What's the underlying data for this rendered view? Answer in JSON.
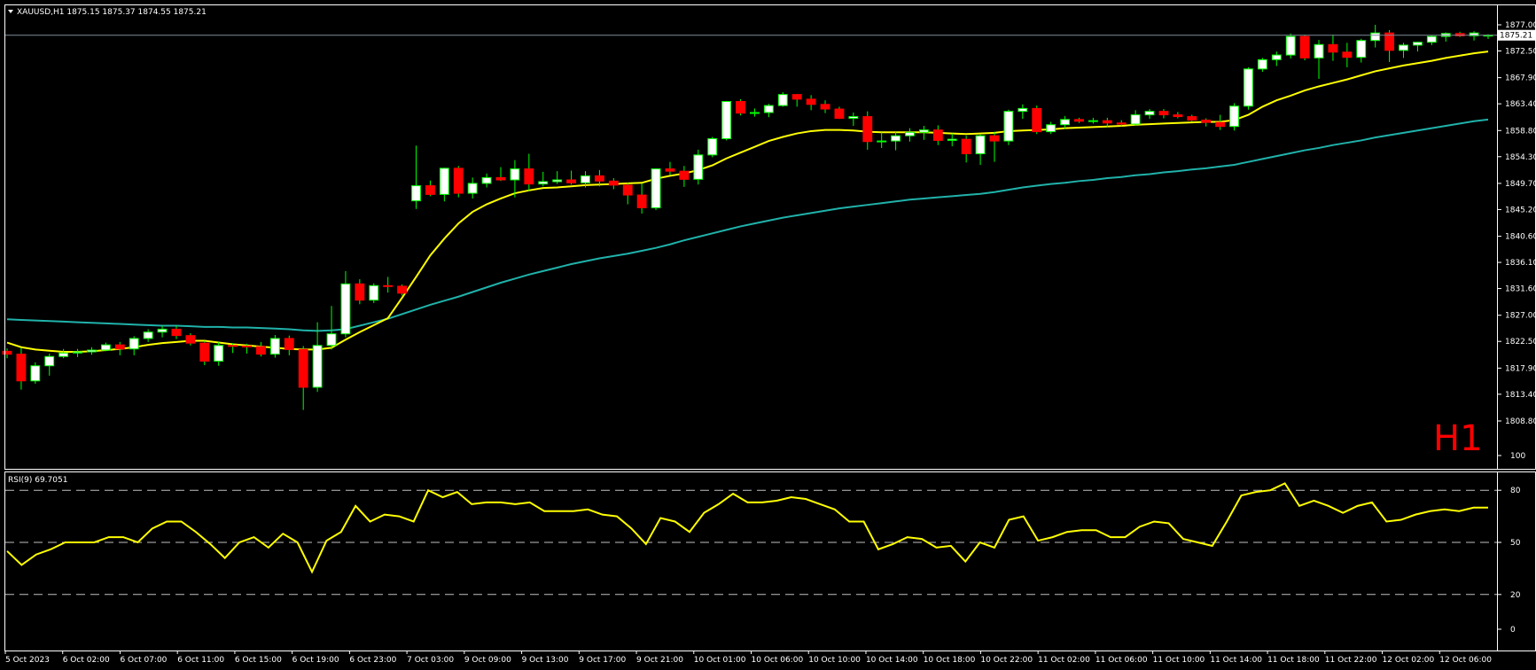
{
  "header": {
    "symbol_line": "XAUUSD,H1  1875.15 1875.37 1874.55 1875.21",
    "timeframe_label": "H1",
    "current_price_label": "1875.21"
  },
  "rsi_panel": {
    "label": "RSI(9) 69.7051"
  },
  "colors": {
    "background": "#000000",
    "frame": "#ffffff",
    "bull_candle": "#ffffff",
    "bear_candle": "#ff0000",
    "wick": "#00ff00",
    "ma_fast": "#ffff00",
    "ma_slow": "#20b2aa",
    "rsi_line": "#ffff00",
    "timeframe_label": "#ff0000"
  },
  "chart_data": [
    {
      "type": "candlestick",
      "title": "XAUUSD,H1",
      "ylim": [
        1808.8,
        1877.0
      ],
      "price_ticks": [
        "1877.00",
        "1872.50",
        "1867.90",
        "1863.40",
        "1858.80",
        "1854.30",
        "1849.70",
        "1845.20",
        "1840.60",
        "1836.10",
        "1831.60",
        "1827.00",
        "1822.50",
        "1817.90",
        "1813.40",
        "1808.80"
      ],
      "time_ticks": [
        "5 Oct 2023",
        "6 Oct 02:00",
        "6 Oct 07:00",
        "6 Oct 11:00",
        "6 Oct 15:00",
        "6 Oct 19:00",
        "6 Oct 23:00",
        "7 Oct 03:00",
        "9 Oct 09:00",
        "9 Oct 13:00",
        "9 Oct 17:00",
        "9 Oct 21:00",
        "10 Oct 01:00",
        "10 Oct 06:00",
        "10 Oct 10:00",
        "10 Oct 14:00",
        "10 Oct 18:00",
        "10 Oct 22:00",
        "11 Oct 02:00",
        "11 Oct 06:00",
        "11 Oct 10:00",
        "11 Oct 14:00",
        "11 Oct 18:00",
        "11 Oct 22:00",
        "12 Oct 02:00",
        "12 Oct 06:00"
      ],
      "last_price": 1875.21,
      "candles_ohlc": [
        [
          1820.8,
          1821.3,
          1819.6,
          1820.3
        ],
        [
          1820.3,
          1821.4,
          1814.2,
          1815.7
        ],
        [
          1815.7,
          1818.9,
          1815.2,
          1818.3
        ],
        [
          1818.3,
          1820.4,
          1816.6,
          1819.9
        ],
        [
          1819.9,
          1821.2,
          1819.6,
          1820.5
        ],
        [
          1820.5,
          1821.2,
          1819.8,
          1820.7
        ],
        [
          1820.7,
          1821.5,
          1820.2,
          1821.0
        ],
        [
          1821.0,
          1822.3,
          1820.8,
          1821.9
        ],
        [
          1821.9,
          1822.4,
          1820.1,
          1821.2
        ],
        [
          1821.2,
          1823.4,
          1820.1,
          1823.0
        ],
        [
          1823.0,
          1824.6,
          1822.4,
          1824.1
        ],
        [
          1824.1,
          1825.2,
          1823.2,
          1824.6
        ],
        [
          1824.6,
          1825.2,
          1822.9,
          1823.5
        ],
        [
          1823.5,
          1823.9,
          1821.8,
          1822.2
        ],
        [
          1822.2,
          1822.6,
          1818.4,
          1819.1
        ],
        [
          1819.1,
          1822.4,
          1818.3,
          1821.8
        ],
        [
          1821.8,
          1822.2,
          1820.5,
          1821.7
        ],
        [
          1821.7,
          1822.1,
          1820.4,
          1821.6
        ],
        [
          1821.6,
          1822.4,
          1819.9,
          1820.3
        ],
        [
          1820.3,
          1823.6,
          1819.7,
          1823.0
        ],
        [
          1823.0,
          1823.5,
          1820.1,
          1821.1
        ],
        [
          1821.1,
          1821.7,
          1810.7,
          1814.6
        ],
        [
          1814.6,
          1825.8,
          1813.8,
          1821.8
        ],
        [
          1821.8,
          1828.6,
          1821.1,
          1823.8
        ],
        [
          1823.8,
          1834.6,
          1823.2,
          1832.4
        ],
        [
          1832.4,
          1833.2,
          1828.9,
          1829.6
        ],
        [
          1829.6,
          1832.5,
          1829.1,
          1832.1
        ],
        [
          1832.1,
          1833.6,
          1830.9,
          1832.0
        ],
        [
          1832.0,
          1832.3,
          1830.4,
          1830.8
        ],
        [
          1846.7,
          1856.2,
          1845.3,
          1849.3
        ],
        [
          1849.3,
          1850.2,
          1847.5,
          1847.8
        ],
        [
          1847.8,
          1852.4,
          1846.6,
          1852.3
        ],
        [
          1852.3,
          1852.7,
          1847.3,
          1848.0
        ],
        [
          1848.0,
          1850.7,
          1847.1,
          1849.7
        ],
        [
          1849.7,
          1851.4,
          1849.0,
          1850.7
        ],
        [
          1850.7,
          1852.5,
          1850.1,
          1850.3
        ],
        [
          1850.3,
          1853.7,
          1847.3,
          1852.2
        ],
        [
          1852.2,
          1854.8,
          1848.4,
          1849.6
        ],
        [
          1849.6,
          1851.7,
          1849.2,
          1850.0
        ],
        [
          1850.0,
          1851.8,
          1849.6,
          1850.3
        ],
        [
          1850.3,
          1851.9,
          1849.5,
          1849.8
        ],
        [
          1849.8,
          1851.8,
          1849.0,
          1851.0
        ],
        [
          1851.0,
          1852.0,
          1849.2,
          1850.1
        ],
        [
          1850.1,
          1850.6,
          1848.7,
          1849.4
        ],
        [
          1849.4,
          1849.8,
          1846.1,
          1847.7
        ],
        [
          1847.7,
          1849.7,
          1844.5,
          1845.5
        ],
        [
          1845.5,
          1852.3,
          1845.1,
          1852.2
        ],
        [
          1852.2,
          1853.4,
          1851.1,
          1851.8
        ],
        [
          1851.8,
          1852.7,
          1849.1,
          1850.4
        ],
        [
          1850.4,
          1855.5,
          1849.5,
          1854.6
        ],
        [
          1854.6,
          1857.7,
          1854.2,
          1857.4
        ],
        [
          1857.4,
          1863.9,
          1857.1,
          1863.8
        ],
        [
          1863.8,
          1864.2,
          1861.4,
          1861.8
        ],
        [
          1861.8,
          1862.6,
          1861.2,
          1861.9
        ],
        [
          1861.9,
          1863.4,
          1861.1,
          1863.1
        ],
        [
          1863.1,
          1865.4,
          1862.9,
          1865.0
        ],
        [
          1865.0,
          1865.1,
          1862.9,
          1864.2
        ],
        [
          1864.2,
          1864.9,
          1862.3,
          1863.3
        ],
        [
          1863.3,
          1864.0,
          1861.8,
          1862.5
        ],
        [
          1862.5,
          1862.9,
          1860.8,
          1860.9
        ],
        [
          1860.9,
          1861.9,
          1859.6,
          1861.2
        ],
        [
          1861.2,
          1862.1,
          1855.5,
          1856.9
        ],
        [
          1856.9,
          1858.5,
          1855.8,
          1857.0
        ],
        [
          1857.0,
          1858.7,
          1855.4,
          1857.9
        ],
        [
          1857.9,
          1859.2,
          1856.9,
          1858.5
        ],
        [
          1858.5,
          1859.6,
          1857.2,
          1858.9
        ],
        [
          1858.9,
          1859.7,
          1856.3,
          1857.1
        ],
        [
          1857.1,
          1858.3,
          1856.1,
          1857.3
        ],
        [
          1857.3,
          1857.9,
          1853.3,
          1854.8
        ],
        [
          1854.8,
          1858.1,
          1852.9,
          1857.9
        ],
        [
          1857.9,
          1858.6,
          1853.4,
          1857.0
        ],
        [
          1857.0,
          1862.4,
          1856.3,
          1862.1
        ],
        [
          1862.1,
          1863.3,
          1860.8,
          1862.6
        ],
        [
          1862.6,
          1863.1,
          1858.2,
          1858.6
        ],
        [
          1858.6,
          1860.3,
          1858.2,
          1859.8
        ],
        [
          1859.8,
          1861.3,
          1859.1,
          1860.7
        ],
        [
          1860.7,
          1861.0,
          1860.1,
          1860.4
        ],
        [
          1860.4,
          1861.0,
          1860.0,
          1860.5
        ],
        [
          1860.5,
          1861.0,
          1859.3,
          1860.1
        ],
        [
          1860.1,
          1860.6,
          1859.5,
          1859.9
        ],
        [
          1859.9,
          1862.3,
          1859.6,
          1861.5
        ],
        [
          1861.5,
          1862.5,
          1860.8,
          1862.1
        ],
        [
          1862.1,
          1862.5,
          1860.9,
          1861.5
        ],
        [
          1861.5,
          1862.0,
          1860.9,
          1861.2
        ],
        [
          1861.2,
          1861.5,
          1860.4,
          1860.6
        ],
        [
          1860.6,
          1860.9,
          1859.5,
          1860.2
        ],
        [
          1860.2,
          1861.5,
          1858.9,
          1859.5
        ],
        [
          1859.5,
          1863.5,
          1858.8,
          1863.0
        ],
        [
          1863.0,
          1869.7,
          1862.4,
          1869.4
        ],
        [
          1869.4,
          1871.3,
          1868.9,
          1871.0
        ],
        [
          1871.0,
          1872.4,
          1869.9,
          1871.8
        ],
        [
          1871.8,
          1875.5,
          1871.2,
          1875.0
        ],
        [
          1875.0,
          1875.3,
          1870.9,
          1871.3
        ],
        [
          1871.3,
          1874.4,
          1867.7,
          1873.6
        ],
        [
          1873.6,
          1875.3,
          1870.8,
          1872.3
        ],
        [
          1872.3,
          1873.9,
          1869.7,
          1871.4
        ],
        [
          1871.4,
          1874.6,
          1870.5,
          1874.3
        ],
        [
          1874.3,
          1877.0,
          1873.1,
          1875.6
        ],
        [
          1875.6,
          1876.1,
          1870.6,
          1872.6
        ],
        [
          1872.6,
          1873.9,
          1871.3,
          1873.5
        ],
        [
          1873.5,
          1874.1,
          1872.4,
          1874.0
        ],
        [
          1874.0,
          1875.2,
          1873.5,
          1875.0
        ],
        [
          1875.0,
          1875.7,
          1874.1,
          1875.5
        ],
        [
          1875.5,
          1875.8,
          1874.9,
          1875.1
        ],
        [
          1875.1,
          1875.9,
          1874.3,
          1875.6
        ],
        [
          1875.15,
          1875.37,
          1874.55,
          1875.21
        ]
      ],
      "ma_fast": [
        1822.3,
        1821.5,
        1821.1,
        1820.9,
        1820.7,
        1820.7,
        1820.8,
        1821.0,
        1821.2,
        1821.5,
        1821.9,
        1822.2,
        1822.4,
        1822.6,
        1822.6,
        1822.3,
        1822.0,
        1821.8,
        1821.6,
        1821.4,
        1821.2,
        1821.1,
        1821.1,
        1821.4,
        1822.8,
        1824.1,
        1825.3,
        1826.5,
        1830.0,
        1833.6,
        1837.3,
        1840.2,
        1842.8,
        1844.8,
        1846.1,
        1847.1,
        1848.0,
        1848.5,
        1848.9,
        1849.0,
        1849.2,
        1849.4,
        1849.5,
        1849.6,
        1849.7,
        1849.8,
        1850.5,
        1851.0,
        1851.4,
        1852.0,
        1852.8,
        1854.0,
        1855.0,
        1856.0,
        1857.0,
        1857.7,
        1858.3,
        1858.7,
        1858.9,
        1858.9,
        1858.8,
        1858.6,
        1858.5,
        1858.5,
        1858.5,
        1858.5,
        1858.4,
        1858.3,
        1858.2,
        1858.3,
        1858.4,
        1858.7,
        1858.8,
        1858.9,
        1859.0,
        1859.2,
        1859.3,
        1859.4,
        1859.5,
        1859.6,
        1859.8,
        1859.9,
        1860.0,
        1860.1,
        1860.2,
        1860.3,
        1860.3,
        1860.6,
        1861.5,
        1862.9,
        1864.0,
        1864.8,
        1865.7,
        1866.4,
        1867.0,
        1867.6,
        1868.3,
        1869.0,
        1869.5,
        1870.0,
        1870.4,
        1870.8,
        1871.3,
        1871.7,
        1872.1,
        1872.4
      ],
      "ma_slow": [
        1826.3,
        1826.2,
        1826.1,
        1826.0,
        1825.9,
        1825.8,
        1825.7,
        1825.6,
        1825.5,
        1825.4,
        1825.3,
        1825.2,
        1825.2,
        1825.1,
        1825.0,
        1825.0,
        1824.9,
        1824.9,
        1824.8,
        1824.7,
        1824.6,
        1824.4,
        1824.3,
        1824.4,
        1824.6,
        1825.2,
        1825.8,
        1826.4,
        1827.2,
        1828.0,
        1828.8,
        1829.5,
        1830.2,
        1831.0,
        1831.8,
        1832.6,
        1833.3,
        1834.0,
        1834.6,
        1835.2,
        1835.8,
        1836.3,
        1836.8,
        1837.2,
        1837.6,
        1838.1,
        1838.6,
        1839.2,
        1839.9,
        1840.5,
        1841.1,
        1841.7,
        1842.3,
        1842.8,
        1843.3,
        1843.8,
        1844.2,
        1844.6,
        1845.0,
        1845.4,
        1845.7,
        1846.0,
        1846.3,
        1846.6,
        1846.9,
        1847.1,
        1847.3,
        1847.5,
        1847.7,
        1847.9,
        1848.2,
        1848.6,
        1849.0,
        1849.3,
        1849.6,
        1849.8,
        1850.1,
        1850.3,
        1850.6,
        1850.8,
        1851.1,
        1851.3,
        1851.6,
        1851.8,
        1852.1,
        1852.3,
        1852.6,
        1852.9,
        1853.4,
        1853.9,
        1854.4,
        1854.9,
        1855.4,
        1855.8,
        1856.3,
        1856.7,
        1857.1,
        1857.6,
        1858.0,
        1858.4,
        1858.8,
        1859.2,
        1859.6,
        1860.0,
        1860.4,
        1860.7
      ]
    },
    {
      "type": "line",
      "title": "RSI(9) 69.7051",
      "ylim": [
        0,
        100
      ],
      "y_ticks": [
        "100",
        "80",
        "50",
        "20",
        "0"
      ],
      "levels": [
        80,
        50,
        20
      ],
      "values": [
        45,
        37,
        43,
        46,
        50,
        50,
        50,
        53,
        53,
        50,
        58,
        62,
        62,
        56,
        49,
        41,
        50,
        53,
        47,
        55,
        50,
        33,
        51,
        56,
        71,
        62,
        66,
        65,
        62,
        80,
        76,
        79,
        72,
        73,
        73,
        72,
        73,
        68,
        68,
        68,
        69,
        66,
        65,
        58,
        49,
        64,
        62,
        56,
        67,
        72,
        78,
        73,
        73,
        74,
        76,
        75,
        72,
        69,
        62,
        62,
        46,
        49,
        53,
        52,
        47,
        48,
        39,
        50,
        47,
        63,
        65,
        51,
        53,
        56,
        57,
        57,
        53,
        53,
        59,
        62,
        61,
        52,
        50,
        48,
        62,
        77,
        79,
        80,
        84,
        71,
        74,
        71,
        67,
        71,
        73,
        62,
        63,
        66,
        68,
        69,
        68,
        70,
        70
      ]
    }
  ]
}
